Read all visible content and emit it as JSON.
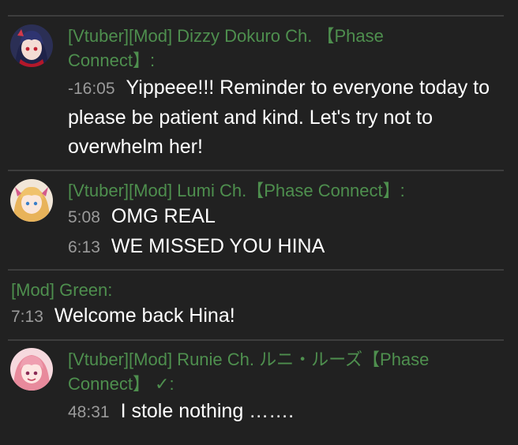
{
  "messages": [
    {
      "author": "[Vtuber][Mod] Dizzy Dokuro Ch. 【Phase Connect】:",
      "avatar": "dizzy-avatar",
      "lines": [
        {
          "timestamp": "-16:05",
          "text": "Yippeee!!! Reminder to everyone today to please be patient and kind. Let's try not to overwhelm her!"
        }
      ]
    },
    {
      "author": "[Vtuber][Mod] Lumi Ch.【Phase Connect】:",
      "avatar": "lumi-avatar",
      "lines": [
        {
          "timestamp": "5:08",
          "text": "OMG REAL"
        },
        {
          "timestamp": "6:13",
          "text": "WE MISSED YOU HINA"
        }
      ]
    },
    {
      "author": "[Mod] Green:",
      "lines": [
        {
          "timestamp": "7:13",
          "text": "Welcome back Hina!"
        }
      ]
    },
    {
      "author": "[Vtuber][Mod] Runie Ch. ルニ・ルーズ【Phase Connect】 ✓:",
      "avatar": "runie-avatar",
      "lines": [
        {
          "timestamp": "48:31",
          "text": "I stole nothing ……."
        }
      ]
    }
  ],
  "colors": {
    "background": "#212121",
    "author": "#4e8f4e",
    "timestamp": "#9a9a9a",
    "message": "#ffffff",
    "divider": "#3d3d3d"
  }
}
